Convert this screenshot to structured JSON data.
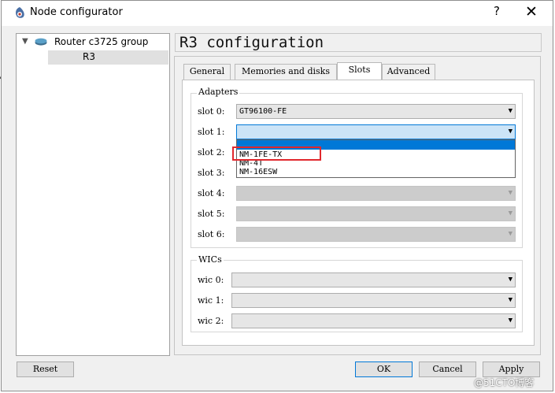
{
  "window": {
    "title": "Node configurator",
    "help_label": "?",
    "close_label": "✕"
  },
  "tree": {
    "group_label": "Router c3725 group",
    "selected_item": "R3"
  },
  "page_title": "R3 configuration",
  "tabs": [
    {
      "label": "General"
    },
    {
      "label": "Memories and disks"
    },
    {
      "label": "Slots"
    },
    {
      "label": "Advanced"
    }
  ],
  "adapters": {
    "title": "Adapters",
    "slots": [
      {
        "label": "slot 0:",
        "value": "GT96100-FE"
      },
      {
        "label": "slot 1:",
        "value": ""
      },
      {
        "label": "slot 2:",
        "value": ""
      },
      {
        "label": "slot 3:",
        "value": ""
      },
      {
        "label": "slot 4:",
        "value": ""
      },
      {
        "label": "slot 5:",
        "value": ""
      },
      {
        "label": "slot 6:",
        "value": ""
      }
    ]
  },
  "dropdown_options": [
    "",
    "NM-1FE-TX",
    "NM-4T",
    "NM-16ESW"
  ],
  "wics": {
    "title": "WICs",
    "slots": [
      {
        "label": "wic 0:",
        "value": ""
      },
      {
        "label": "wic 1:",
        "value": ""
      },
      {
        "label": "wic 2:",
        "value": ""
      }
    ]
  },
  "buttons": {
    "reset": "Reset",
    "ok": "OK",
    "cancel": "Cancel",
    "apply": "Apply"
  },
  "watermark": "@51CTO博客",
  "colors": {
    "highlight_box": "#e1282d",
    "selection": "#0078d7",
    "focus": "#cce4f7"
  }
}
